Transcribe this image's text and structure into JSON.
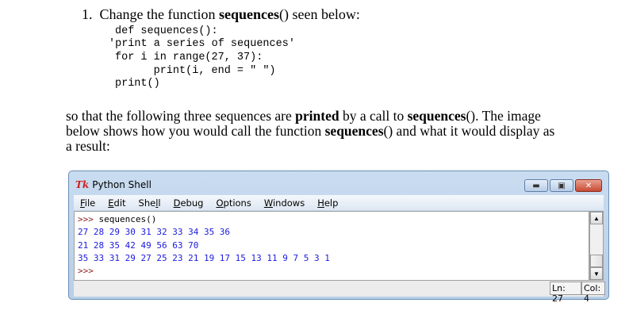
{
  "question": {
    "number": "1.",
    "intro_pre": "Change the function ",
    "intro_bold": "sequences",
    "intro_post": "() seen below:",
    "code_lines": [
      "def sequences():",
      "'print a series of sequences'",
      "for i in range(27, 37):",
      "      print(i, end = \" \")",
      "print()"
    ],
    "para_pre": "so that the following three sequences are ",
    "para_bold1": "printed",
    "para_mid": " by a call to ",
    "para_bold2": "sequences",
    "para_mid2": "().  The image below shows how you would call the function ",
    "para_bold3": "sequences",
    "para_post": "() and what it would display as a result:"
  },
  "window": {
    "app_icon": "Tk",
    "title": "Python Shell",
    "buttons": {
      "minimize": "minimize-icon",
      "maximize": "maximize-icon",
      "close": "close-icon"
    },
    "menu": [
      {
        "u": "F",
        "rest": "ile"
      },
      {
        "u": "E",
        "rest": "dit"
      },
      {
        "pre": "She",
        "u": "l",
        "rest": "l"
      },
      {
        "u": "D",
        "rest": "ebug"
      },
      {
        "u": "O",
        "rest": "ptions"
      },
      {
        "u": "W",
        "rest": "indows"
      },
      {
        "u": "H",
        "rest": "elp"
      }
    ],
    "shell": {
      "prompt": ">>>",
      "command": "sequences()",
      "output": [
        "27 28 29 30 31 32 33 34 35 36",
        "21 28 35 42 49 56 63 70",
        "35 33 31 29 27 25 23 21 19 17 15 13 11 9 7 5 3 1"
      ]
    },
    "status": {
      "line": "Ln: 27",
      "col": "Col: 4"
    },
    "colors": {
      "prompt": "#8b2020",
      "output": "#1a1ae0"
    }
  }
}
